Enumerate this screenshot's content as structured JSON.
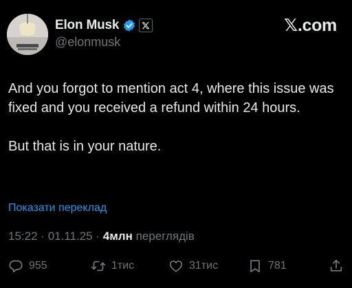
{
  "header": {
    "display_name": "Elon Musk",
    "handle": "@elonmusk",
    "brand": "𝕏.com",
    "verified_color": "#1d9bf0"
  },
  "post": {
    "paragraphs": [
      "And you forgot to mention act 4, where this issue was fixed and you received a refund within 24 hours.",
      "But that is in your nature."
    ],
    "translate_label": "Показати переклад"
  },
  "meta": {
    "time": "15:22",
    "date": "01.11.25",
    "views_count": "4млн",
    "views_label": "переглядів",
    "separator": "·"
  },
  "actions": {
    "replies": "955",
    "reposts": "1тис",
    "likes": "31тис",
    "bookmarks": "781"
  },
  "icons": {
    "reply": "comment-icon",
    "repost": "repost-icon",
    "like": "heart-icon",
    "bookmark": "bookmark-icon",
    "share": "share-icon",
    "verified": "verified-badge-icon",
    "affiliation": "x-logo-icon"
  },
  "colors": {
    "background": "#000000",
    "text": "#e7e9ea",
    "secondary": "#71767b",
    "link": "#1d9bf0"
  }
}
